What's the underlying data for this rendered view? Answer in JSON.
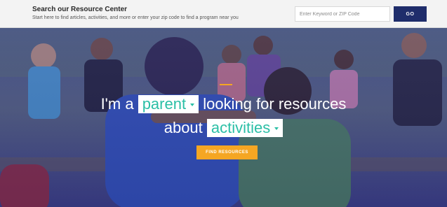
{
  "search": {
    "title": "Search our Resource Center",
    "subtitle": "Start here to find articles, activities, and more or enter your zip code to find a program near you",
    "placeholder": "Enter Keyword or ZIP Code",
    "go_label": "GO"
  },
  "hero": {
    "prefix": "I'm a",
    "role_selected": "parent",
    "middle": "looking for resources",
    "about": "about",
    "topic_selected": "activities",
    "cta_label": "FIND RESOURCES",
    "colors": {
      "overlay": "#3c3f8a",
      "accent": "#f5a623",
      "select_text": "#2bbfa6",
      "search_button": "#1f2d6b"
    }
  }
}
